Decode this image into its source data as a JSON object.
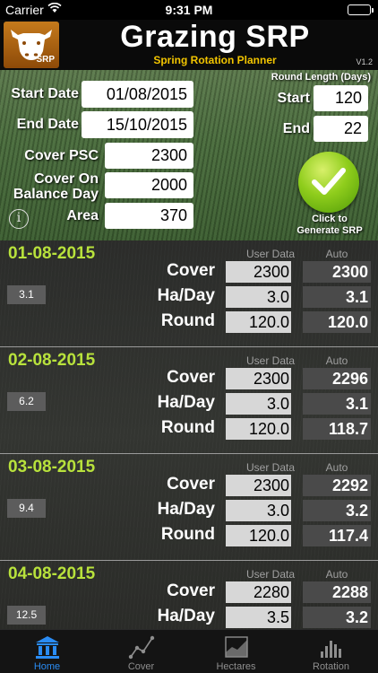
{
  "status_bar": {
    "carrier": "Carrier",
    "time": "9:31 PM"
  },
  "header": {
    "title": "Grazing SRP",
    "subtitle": "Spring Rotation Planner",
    "version": "V1.2",
    "logo_text": "SRP"
  },
  "inputs": {
    "start_date_label": "Start Date",
    "start_date": "01/08/2015",
    "end_date_label": "End Date",
    "end_date": "15/10/2015",
    "cover_psc_label": "Cover PSC",
    "cover_psc": "2300",
    "cover_balance_label_1": "Cover On",
    "cover_balance_label_2": "Balance Day",
    "cover_balance": "2000",
    "area_label": "Area",
    "area": "370",
    "round_length_label": "Round Length (Days)",
    "round_start_label": "Start",
    "round_start": "120",
    "round_end_label": "End",
    "round_end": "22",
    "generate_caption_1": "Click to",
    "generate_caption_2": "Generate SRP"
  },
  "list": {
    "user_header": "User Data",
    "auto_header": "Auto",
    "row_labels": {
      "cover": "Cover",
      "ha_day": "Ha/Day",
      "round": "Round"
    },
    "days": [
      {
        "date": "01-08-2015",
        "badge": "3.1",
        "user": {
          "cover": "2300",
          "ha_day": "3.0",
          "round": "120.0"
        },
        "auto": {
          "cover": "2300",
          "ha_day": "3.1",
          "round": "120.0"
        }
      },
      {
        "date": "02-08-2015",
        "badge": "6.2",
        "user": {
          "cover": "2300",
          "ha_day": "3.0",
          "round": "120.0"
        },
        "auto": {
          "cover": "2296",
          "ha_day": "3.1",
          "round": "118.7"
        }
      },
      {
        "date": "03-08-2015",
        "badge": "9.4",
        "user": {
          "cover": "2300",
          "ha_day": "3.0",
          "round": "120.0"
        },
        "auto": {
          "cover": "2292",
          "ha_day": "3.2",
          "round": "117.4"
        }
      },
      {
        "date": "04-08-2015",
        "badge": "12.5",
        "user": {
          "cover": "2280",
          "ha_day": "3.5",
          "round": ""
        },
        "auto": {
          "cover": "2288",
          "ha_day": "3.2",
          "round": ""
        }
      }
    ]
  },
  "tabs": [
    {
      "label": "Home",
      "icon": "bank-icon",
      "active": true
    },
    {
      "label": "Cover",
      "icon": "line-chart-icon",
      "active": false
    },
    {
      "label": "Hectares",
      "icon": "area-chart-icon",
      "active": false
    },
    {
      "label": "Rotation",
      "icon": "bar-chart-icon",
      "active": false
    }
  ],
  "colors": {
    "accent_blue": "#2a8cf4",
    "date_green": "#b8e23c",
    "subtitle_yellow": "#f2c500",
    "logo_orange": "#c57a1c"
  }
}
